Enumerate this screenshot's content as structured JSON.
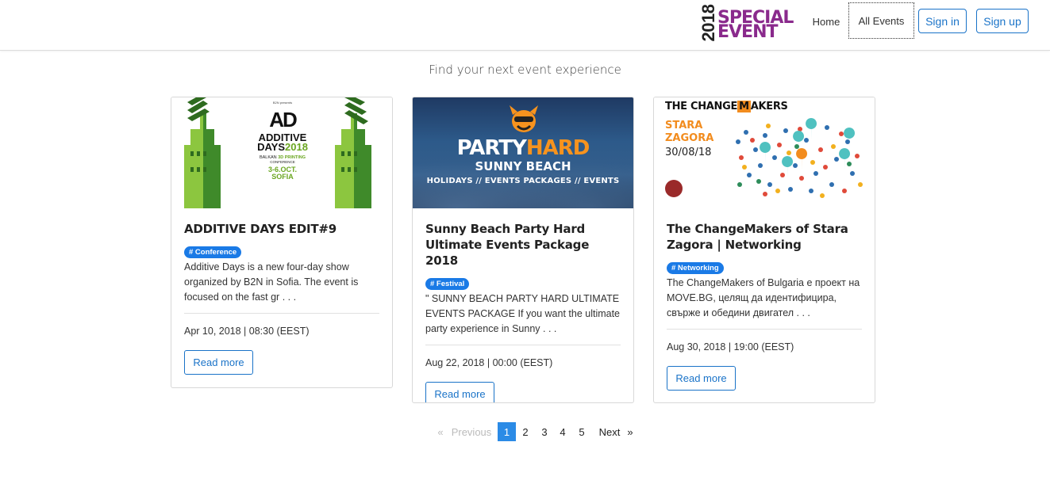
{
  "nav": {
    "brand_year": "2018",
    "brand_line1": "SPECIAL",
    "brand_line2": "EVENT",
    "home": "Home",
    "all_events": "All Events",
    "sign_in": "Sign in",
    "sign_up": "Sign up"
  },
  "tagline": "Find your next event experience",
  "events": [
    {
      "title": "ADDITIVE DAYS EDIT#9",
      "tag": "# Conference",
      "description": "Additive Days is a new four-day show organized by B2N in Sofia. The event is focused on the fast gr . . .",
      "date": "Apr 10, 2018 | 08:30 (EEST)",
      "read_more": "Read more",
      "image": {
        "presents": "B2N presents",
        "logo": "AD",
        "line1a": "ADDITIVE",
        "line1b": "DAYS",
        "line1c": "2018",
        "line2a": "BALKAN ",
        "line2b": "3D PRINTING",
        "line3": "CONFERENCE",
        "line4a": "3-6.OCT.",
        "line4b": "SOFIA"
      }
    },
    {
      "title": "Sunny Beach Party Hard Ultimate Events Package 2018",
      "tag": "# Festival",
      "description": "\" SUNNY BEACH PARTY HARD ULTIMATE EVENTS PACKAGE If you want the ultimate party experience in Sunny . . .",
      "date": "Aug 22, 2018 | 00:00 (EEST)",
      "read_more": "Read more",
      "image": {
        "party": "PARTY",
        "hard": "HARD",
        "sub": "SUNNY BEACH",
        "strip": "HOLIDAYS // EVENTS PACKAGES // EVENTS"
      }
    },
    {
      "title": "The ChangeMakers of Stara Zagora | Networking",
      "tag": "# Networking",
      "description": "The ChangeMakers of Bulgaria е проект на MOVE.BG, целящ да идентифицира, свърже и обедини двигател . . .",
      "date": "Aug 30, 2018 | 19:00 (EEST)",
      "read_more": "Read more",
      "image": {
        "head_a": "THE CHANGE",
        "head_m": "M",
        "head_b": "AKERS",
        "city1": "STARA",
        "city2": "ZAGORA",
        "date": "30/08/18"
      }
    }
  ],
  "pagination": {
    "prev_arrow": "«",
    "previous": "Previous",
    "pages": [
      "1",
      "2",
      "3",
      "4",
      "5"
    ],
    "current_page": "1",
    "next": "Next",
    "next_arrow": "»"
  },
  "colors": {
    "brand_purple": "#8a2a8c",
    "link_blue": "#1a73c8",
    "badge_blue": "#1a7ae6",
    "active_page": "#2b8be6",
    "additive_green": "#6aa620",
    "party_orange": "#f7931e",
    "changemakers_orange": "#f28c1e"
  }
}
